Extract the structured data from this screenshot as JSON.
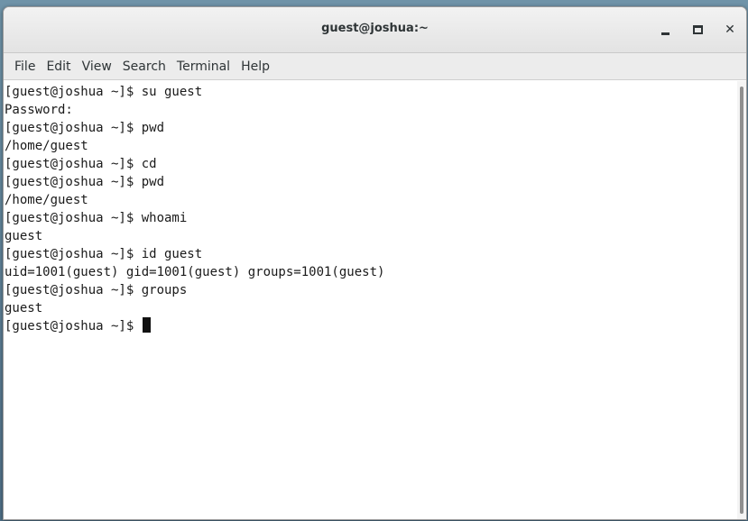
{
  "window": {
    "title": "guest@joshua:~",
    "controls": {
      "minimize_icon": "minimize-icon",
      "maximize_icon": "maximize-icon",
      "close_icon": "close-icon",
      "close_glyph": "✕"
    }
  },
  "menubar": {
    "items": [
      "File",
      "Edit",
      "View",
      "Search",
      "Terminal",
      "Help"
    ]
  },
  "terminal": {
    "lines": [
      "[guest@joshua ~]$ su guest",
      "Password:",
      "[guest@joshua ~]$ pwd",
      "/home/guest",
      "[guest@joshua ~]$ cd",
      "[guest@joshua ~]$ pwd",
      "/home/guest",
      "[guest@joshua ~]$ whoami",
      "guest",
      "[guest@joshua ~]$ id guest",
      "uid=1001(guest) gid=1001(guest) groups=1001(guest)",
      "[guest@joshua ~]$ groups",
      "guest"
    ],
    "prompt": "[guest@joshua ~]$ "
  },
  "colors": {
    "titlebar": "#e8e8e8",
    "menubar": "#ececec",
    "terminal_bg": "#ffffff",
    "terminal_fg": "#1a1a1a",
    "desktop": "#5e7f99"
  }
}
